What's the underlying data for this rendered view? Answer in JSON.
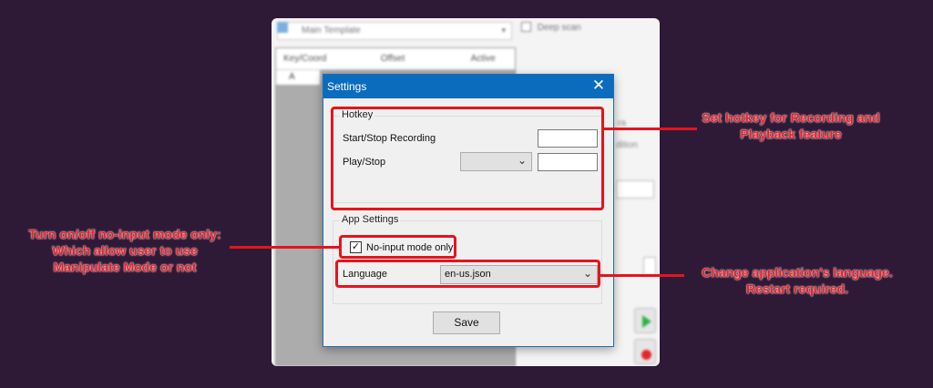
{
  "background_app": {
    "combo_value": "Main Template",
    "deep_scan_label": "Deep scan",
    "table_headers": [
      "Key/Coord",
      "Offset",
      "Active"
    ],
    "table_row_first": "A",
    "right_text_1": "ra",
    "right_text_2": "dition"
  },
  "dialog": {
    "title": "Settings",
    "hotkey_group": {
      "legend": "Hotkey",
      "start_stop_label": "Start/Stop Recording",
      "start_stop_value": "",
      "play_stop_label": "Play/Stop",
      "play_stop_modifier": "",
      "play_stop_value": ""
    },
    "app_settings_group": {
      "legend": "App Settings",
      "no_input_label": "No-input mode only",
      "no_input_checked": true,
      "language_label": "Language",
      "language_value": "en-us.json"
    },
    "save_label": "Save"
  },
  "annotations": {
    "hotkey_note": "Set hotkey for Recording and Playback feature",
    "no_input_note": "Turn on/off no-input mode only: Which allow user to use Manipulate Mode or not",
    "language_note": "Change application's language. Restart required."
  },
  "colors": {
    "page_background": "#2e1a37",
    "accent_red": "#e5141c",
    "titlebar_blue": "#0b6cbd"
  }
}
